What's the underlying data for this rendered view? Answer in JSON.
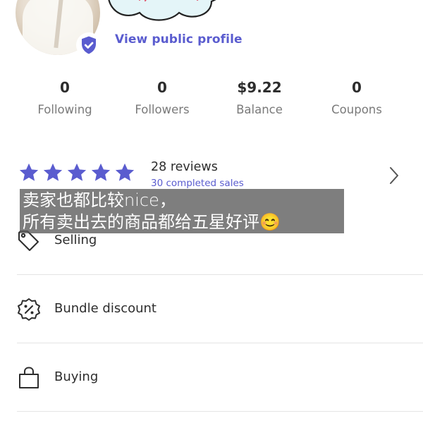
{
  "profile": {
    "view_public_profile_label": "View public profile"
  },
  "stats": [
    {
      "value": "0",
      "label": "Following"
    },
    {
      "value": "0",
      "label": "Followers"
    },
    {
      "value": "$9.22",
      "label": "Balance"
    },
    {
      "value": "0",
      "label": "Coupons"
    }
  ],
  "reviews": {
    "rating_stars": 5,
    "count_label": "28 reviews",
    "completed_sales_label": "30 completed sales"
  },
  "subtitle": {
    "line1": "卖家也都比较nice，",
    "line2": "所有卖出去的商品都给五星好评😊"
  },
  "menu": [
    {
      "label": "Selling",
      "icon": "tag-icon"
    },
    {
      "label": "Bundle discount",
      "icon": "percent-badge-icon"
    },
    {
      "label": "Buying",
      "icon": "shopping-bag-icon"
    }
  ],
  "colors": {
    "accent": "#5a5ccf",
    "text": "#2d2d2d",
    "muted": "#7a7a7a",
    "divider": "#e4e4e4"
  }
}
